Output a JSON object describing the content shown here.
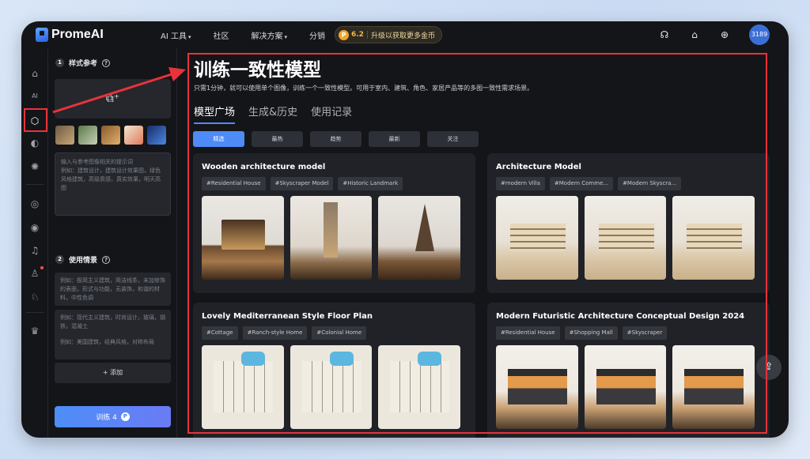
{
  "header": {
    "logo_text": "PromeAI",
    "nav": [
      {
        "label": "AI 工具",
        "has_menu": true
      },
      {
        "label": "社区",
        "has_menu": false
      },
      {
        "label": "解决方案",
        "has_menu": true
      },
      {
        "label": "分销",
        "has_menu": false
      }
    ],
    "upgrade": {
      "coins": "6.2",
      "text": "升级以获取更多金币"
    },
    "avatar_text": "3189",
    "icons": [
      "headset-icon",
      "graduation-cap-icon",
      "globe-icon"
    ]
  },
  "panel": {
    "step1": {
      "num": "1",
      "title": "样式参考"
    },
    "upload_icon": "image-add-icon",
    "prompt_placeholder": "输入与参考图像相关的提示词\n例如：建筑设计，建筑设计效果图，绿色风格建筑，高级质感，真实效果，明天高图",
    "step2": {
      "num": "2",
      "title": "使用情景"
    },
    "scenes": [
      "例如：极简主义建筑，简洁线条，未加修饰的表面，形式与功能，无装饰，和谐的材料，中性色调",
      "例如：现代主义建筑，时尚设计，玻璃，钢铁，混凝土",
      "例如：美国建筑，经典风格，对称布局"
    ],
    "add_label": "+ 添加",
    "train_label": "训练 4"
  },
  "main": {
    "title": "训练一致性模型",
    "subtitle": "只需1分钟，就可以使用单个图像，训练一个一致性模型。可用于室内、建筑、角色、家居产品等的多图一致性需求场景。",
    "tabs": [
      "模型广场",
      "生成&历史",
      "使用记录"
    ],
    "filters": [
      "精选",
      "最热",
      "趋势",
      "最新",
      "关注"
    ],
    "cards": [
      {
        "title": "Wooden architecture model",
        "tags": [
          "#Residential House",
          "#Skyscraper Model",
          "#Historic Landmark"
        ]
      },
      {
        "title": "Architecture Model",
        "tags": [
          "#modern Villa",
          "#Modern Comme...",
          "#Modern Skyscra..."
        ]
      },
      {
        "title": "Lovely Mediterranean Style Floor Plan",
        "tags": [
          "#Cottage",
          "#Ranch-style Home",
          "#Colonial Home"
        ]
      },
      {
        "title": "Modern Futuristic Architecture Conceptual Design 2024",
        "tags": [
          "#Residential House",
          "#Shopping Mall",
          "#Skyscraper"
        ]
      }
    ]
  },
  "colors": {
    "accent": "#4e8bf6",
    "highlight": "#e8333a",
    "coin": "#f2a52a"
  }
}
